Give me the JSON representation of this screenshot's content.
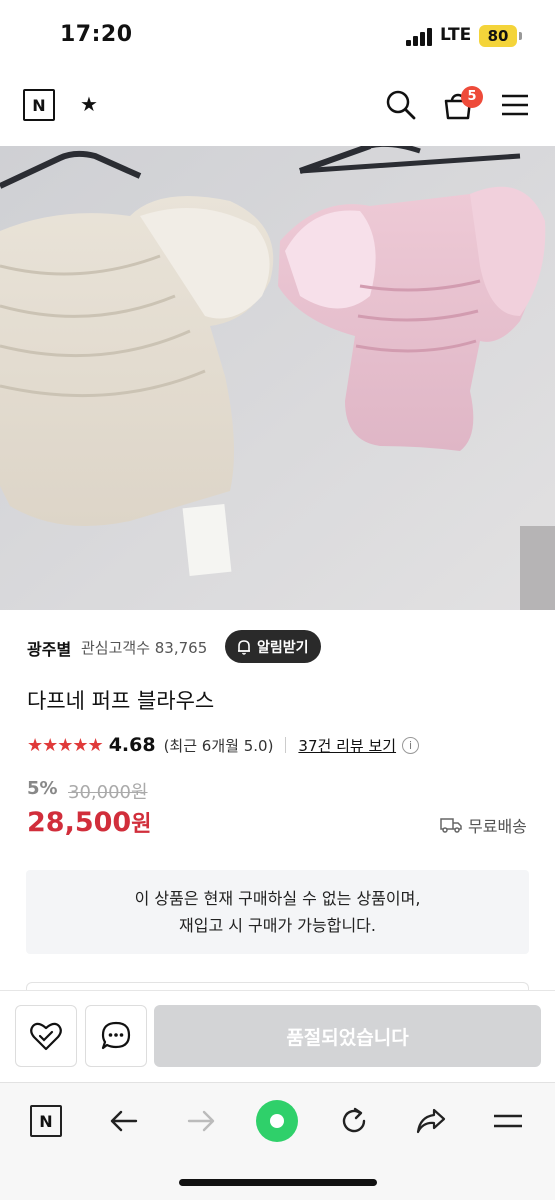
{
  "status_bar": {
    "time": "17:20",
    "network": "LTE",
    "battery": "80"
  },
  "header": {
    "logo": "N",
    "star": "★",
    "cart_count": "5"
  },
  "seller": {
    "name": "광주별",
    "followers": "관심고객수 83,765",
    "alert_button": "알림받기"
  },
  "product": {
    "title": "다프네 퍼프 블라우스",
    "rating": "4.68",
    "rating_recent": "(최근 6개월 5.0)",
    "review_link": "37건 리뷰 보기",
    "discount": "5%",
    "original_price": "30,000원",
    "price": "28,500",
    "price_unit": "원",
    "shipping": "무료배송",
    "stars": 4.68
  },
  "notice": {
    "line1": "이 상품은 현재 구매하실 수 없는 상품이며,",
    "line2": "재입고 시 구매가 가능합니다."
  },
  "action_bar": {
    "soldout_label": "품절되었습니다"
  },
  "browser_bar": {
    "logo": "N"
  },
  "colors": {
    "price": "#d12e3b",
    "star": "#e03a3a",
    "badge": "#ee4b3a",
    "battery": "#f4d43a",
    "green": "#2fd06a"
  }
}
